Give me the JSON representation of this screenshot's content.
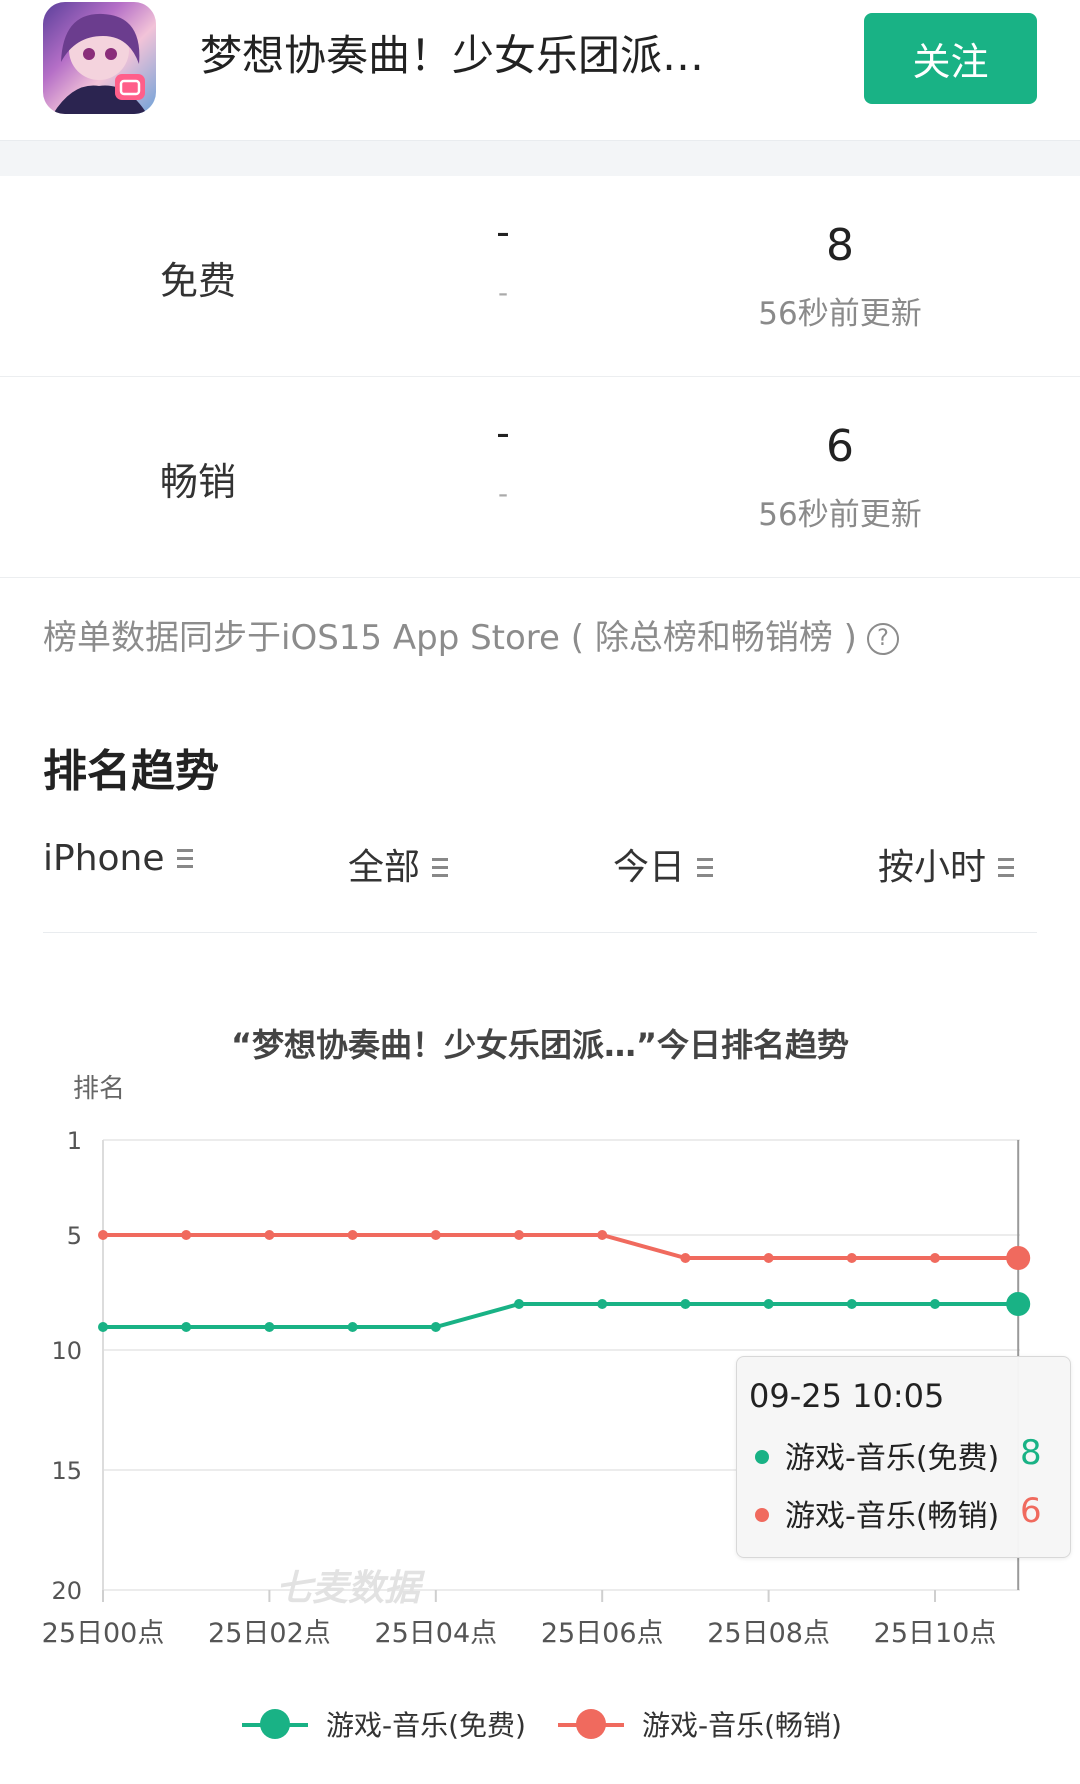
{
  "app": {
    "title": "梦想协奏曲！少女乐团派…",
    "follow_label": "关注"
  },
  "ranks": [
    {
      "label": "免费",
      "prev": "-",
      "prev_delta": "-",
      "value": "8",
      "updated": "56秒前更新"
    },
    {
      "label": "畅销",
      "prev": "-",
      "prev_delta": "-",
      "value": "6",
      "updated": "56秒前更新"
    }
  ],
  "note": {
    "text": "榜单数据同步于iOS15 App Store ( 除总榜和畅销榜 )",
    "icon": "help-circle-icon"
  },
  "section": {
    "title": "排名趋势"
  },
  "filters": [
    {
      "label": "iPhone",
      "icon": "menu-icon"
    },
    {
      "label": "全部",
      "icon": "menu-icon"
    },
    {
      "label": "今日",
      "icon": "menu-icon"
    },
    {
      "label": "按小时",
      "icon": "menu-icon"
    }
  ],
  "chart_data": {
    "type": "line",
    "title": "“梦想协奏曲！少女乐团派…”今日排名趋势",
    "ylabel": "排名",
    "xlabel": "",
    "y_inverted": true,
    "ylim": [
      1,
      20
    ],
    "y_ticks": [
      "1",
      "5",
      "10",
      "15",
      "20"
    ],
    "x_tick_labels": [
      "25日00点",
      "25日02点",
      "25日04点",
      "25日06点",
      "25日08点",
      "25日10点"
    ],
    "x_hours": [
      0,
      1,
      2,
      3,
      4,
      5,
      6,
      7,
      8,
      9,
      10,
      11
    ],
    "series": [
      {
        "name": "游戏-音乐(免费)",
        "color": "#19b285",
        "values": [
          9,
          9,
          9,
          9,
          9,
          8,
          8,
          8,
          8,
          8,
          8,
          8
        ]
      },
      {
        "name": "游戏-音乐(畅销)",
        "color": "#f06a5e",
        "values": [
          5,
          5,
          5,
          5,
          5,
          5,
          5,
          6,
          6,
          6,
          6,
          6
        ]
      }
    ],
    "watermark": "七麦数据",
    "grid": true,
    "legend_position": "bottom"
  },
  "tooltip": {
    "time": "09-25 10:05",
    "rows": [
      {
        "name": "游戏-音乐(免费)",
        "value": "8",
        "color": "#19b285"
      },
      {
        "name": "游戏-音乐(畅销)",
        "value": "6",
        "color": "#f06a5e"
      }
    ]
  }
}
